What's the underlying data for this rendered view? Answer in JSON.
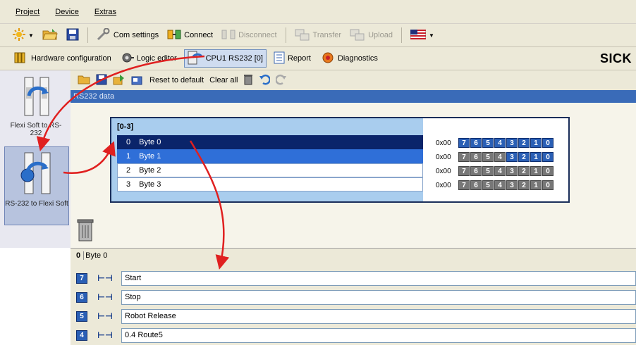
{
  "menu": {
    "items": [
      "Project",
      "Device",
      "Extras"
    ]
  },
  "toolbar": {
    "com_settings": "Com settings",
    "connect": "Connect",
    "disconnect": "Disconnect",
    "transfer": "Transfer",
    "upload": "Upload"
  },
  "tabs": {
    "hardware": "Hardware configuration",
    "logic": "Logic editor",
    "cpu": "CPU1 RS232 [0]",
    "report": "Report",
    "diagnostics": "Diagnostics"
  },
  "brand": "SICK",
  "sidebar": {
    "items": [
      {
        "label": "Flexi Soft to RS-232"
      },
      {
        "label": "RS-232 to Flexi Soft"
      }
    ]
  },
  "editor_toolbar": {
    "reset": "Reset to default",
    "clear": "Clear all"
  },
  "section_header": "RS232 data",
  "block": {
    "title": "[0-3]",
    "rows": [
      {
        "index": "0",
        "label": "Byte 0"
      },
      {
        "index": "1",
        "label": "Byte 1"
      },
      {
        "index": "2",
        "label": "Byte 2"
      },
      {
        "index": "3",
        "label": "Byte 3"
      }
    ],
    "bytes": [
      {
        "hex": "0x00",
        "bits": [
          "7",
          "6",
          "5",
          "4",
          "3",
          "2",
          "1",
          "0"
        ],
        "state": [
          1,
          1,
          1,
          1,
          1,
          1,
          1,
          1
        ]
      },
      {
        "hex": "0x00",
        "bits": [
          "7",
          "6",
          "5",
          "4",
          "3",
          "2",
          "1",
          "0"
        ],
        "state": [
          0,
          0,
          0,
          0,
          1,
          1,
          1,
          1
        ]
      },
      {
        "hex": "0x00",
        "bits": [
          "7",
          "6",
          "5",
          "4",
          "3",
          "2",
          "1",
          "0"
        ],
        "state": [
          0,
          0,
          0,
          0,
          0,
          0,
          0,
          0
        ]
      },
      {
        "hex": "0x00",
        "bits": [
          "7",
          "6",
          "5",
          "4",
          "3",
          "2",
          "1",
          "0"
        ],
        "state": [
          0,
          0,
          0,
          0,
          0,
          0,
          0,
          0
        ]
      }
    ]
  },
  "properties": {
    "index": "0",
    "name": "Byte 0",
    "rows": [
      {
        "bit": "7",
        "value": "Start"
      },
      {
        "bit": "6",
        "value": "Stop"
      },
      {
        "bit": "5",
        "value": "Robot Release"
      },
      {
        "bit": "4",
        "value": "0.4 Route5"
      }
    ]
  },
  "colors": {
    "selection_dark": "#0a246a",
    "selection_light": "#2f6fd8",
    "bit_on": "#2a5fb5",
    "arrow": "#e02020"
  }
}
